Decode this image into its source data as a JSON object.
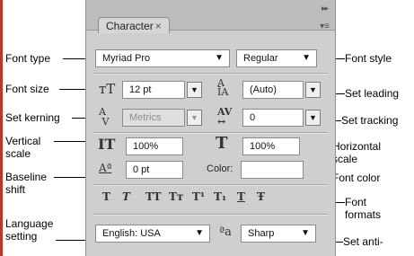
{
  "panel": {
    "tab_label": "Character",
    "tab_close": "×",
    "menu_glyph": "▾≡",
    "arrows_glyph": "▸▸"
  },
  "controls": {
    "font_family": "Myriad Pro",
    "font_style": "Regular",
    "font_size": "12 pt",
    "leading": "(Auto)",
    "kerning": "Metrics",
    "tracking": "0",
    "vertical_scale": "100%",
    "horizontal_scale": "100%",
    "baseline_shift": "0 pt",
    "color_label": "Color:",
    "language": "English: USA",
    "antialias": "Sharp"
  },
  "format_buttons": [
    "T",
    "T",
    "TT",
    "Tт",
    "T¹",
    "T₁",
    "T",
    "Ŧ"
  ],
  "icons": {
    "font_size": "ᴛT",
    "leading": "A̲A",
    "kerning": "AV",
    "tracking": "AV",
    "vscale": "IT",
    "hscale": "T",
    "baseline": "Aª",
    "aa": "ªa"
  },
  "callouts": {
    "font_type": "Font type",
    "font_size": "Font size",
    "set_kerning": "Set kerning",
    "vertical_scale": "Vertical scale",
    "baseline_shift": "Baseline shift",
    "language_setting": "Language setting",
    "font_style": "Font style",
    "set_leading": "Set leading",
    "set_tracking": "Set tracking",
    "horizontal_scale": "Horizontal scale",
    "font_color": "Font color",
    "font_formats": "Font formats",
    "set_anti": "Set anti-"
  }
}
